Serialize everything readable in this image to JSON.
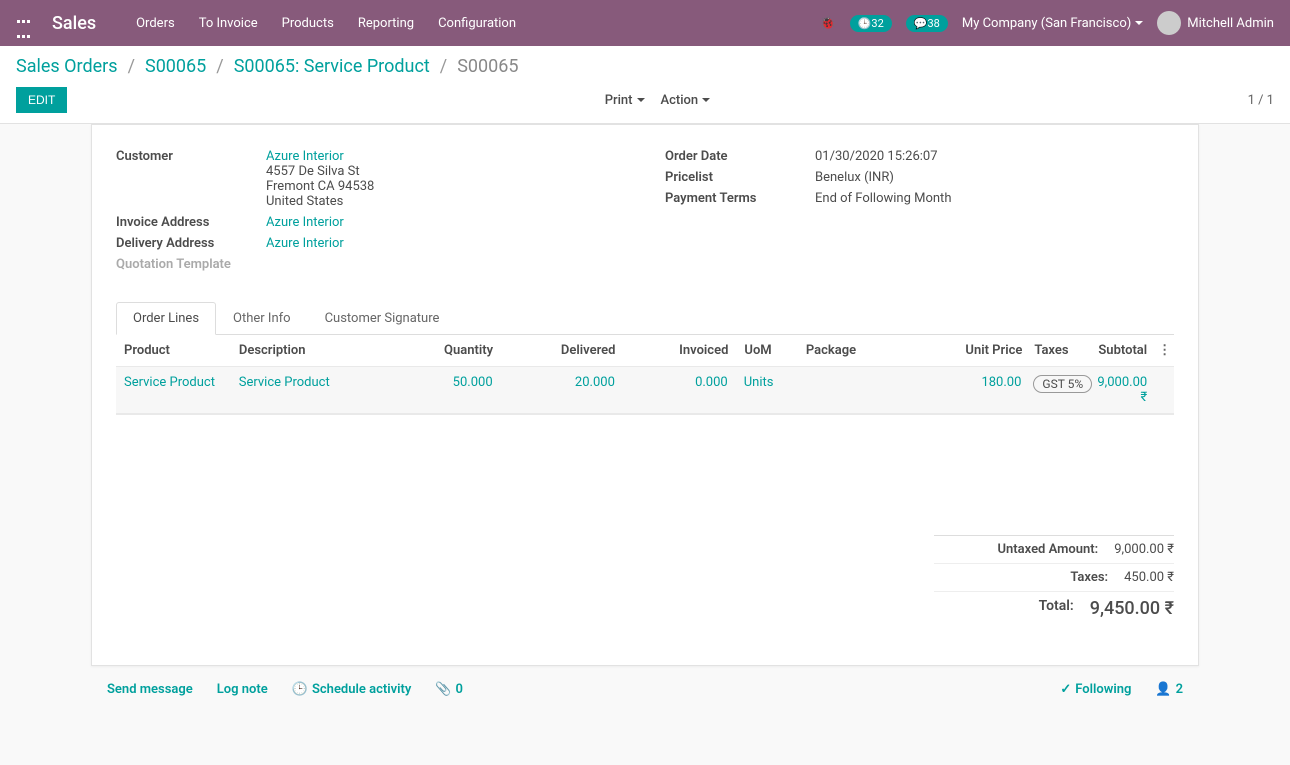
{
  "navbar": {
    "brand": "Sales",
    "menu": [
      "Orders",
      "To Invoice",
      "Products",
      "Reporting",
      "Configuration"
    ],
    "clock_badge": "32",
    "chat_badge": "38",
    "company": "My Company (San Francisco)",
    "user": "Mitchell Admin"
  },
  "breadcrumb": {
    "items": [
      "Sales Orders",
      "S00065",
      "S00065: Service Product"
    ],
    "active": "S00065"
  },
  "controls": {
    "edit": "EDIT",
    "print": "Print",
    "action": "Action",
    "pager": "1 / 1"
  },
  "form": {
    "customer_label": "Customer",
    "customer_name": "Azure Interior",
    "addr1": "4557 De Silva St",
    "addr2": "Fremont CA 94538",
    "addr3": "United States",
    "invoice_addr_label": "Invoice Address",
    "invoice_addr": "Azure Interior",
    "delivery_addr_label": "Delivery Address",
    "delivery_addr": "Azure Interior",
    "quote_tpl_label": "Quotation Template",
    "order_date_label": "Order Date",
    "order_date": "01/30/2020 15:26:07",
    "pricelist_label": "Pricelist",
    "pricelist": "Benelux (INR)",
    "payterm_label": "Payment Terms",
    "payterm": "End of Following Month"
  },
  "tabs": [
    "Order Lines",
    "Other Info",
    "Customer Signature"
  ],
  "table": {
    "headers": {
      "product": "Product",
      "description": "Description",
      "quantity": "Quantity",
      "delivered": "Delivered",
      "invoiced": "Invoiced",
      "uom": "UoM",
      "package": "Package",
      "unit_price": "Unit Price",
      "taxes": "Taxes",
      "subtotal": "Subtotal"
    },
    "row": {
      "product": "Service Product",
      "description": "Service Product",
      "quantity": "50.000",
      "delivered": "20.000",
      "invoiced": "0.000",
      "uom": "Units",
      "unit_price": "180.00",
      "tax": "GST 5%",
      "subtotal": "9,000.00 ₹"
    }
  },
  "totals": {
    "untaxed_label": "Untaxed Amount:",
    "untaxed": "9,000.00 ₹",
    "taxes_label": "Taxes:",
    "taxes": "450.00 ₹",
    "total_label": "Total:",
    "total": "9,450.00 ₹"
  },
  "chatter": {
    "send": "Send message",
    "log": "Log note",
    "schedule": "Schedule activity",
    "attach": "0",
    "following": "Following",
    "followers": "2"
  }
}
